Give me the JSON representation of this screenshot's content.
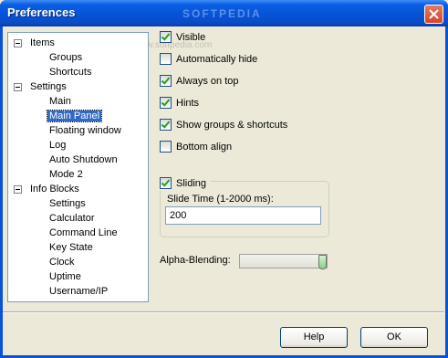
{
  "window": {
    "title": "Preferences",
    "watermark": "SOFTPEDIA",
    "watermark_url": "www.softpedia.com"
  },
  "tree": {
    "items": [
      {
        "label": "Items",
        "toggle": true
      },
      {
        "label": "Groups"
      },
      {
        "label": "Shortcuts"
      },
      {
        "label": "Settings",
        "toggle": true
      },
      {
        "label": "Main"
      },
      {
        "label": "Main Panel",
        "selected": true
      },
      {
        "label": "Floating window"
      },
      {
        "label": "Log"
      },
      {
        "label": "Auto Shutdown"
      },
      {
        "label": "Mode 2"
      },
      {
        "label": "Info Blocks",
        "toggle": true
      },
      {
        "label": "Settings"
      },
      {
        "label": "Calculator"
      },
      {
        "label": "Command Line"
      },
      {
        "label": "Key State"
      },
      {
        "label": "Clock"
      },
      {
        "label": "Uptime"
      },
      {
        "label": "Username/IP"
      }
    ]
  },
  "options": [
    {
      "label": "Visible",
      "checked": true
    },
    {
      "label": "Automatically hide",
      "checked": false
    },
    {
      "label": "Always on top",
      "checked": true
    },
    {
      "label": "Hints",
      "checked": true
    },
    {
      "label": "Show groups & shortcuts",
      "checked": true
    },
    {
      "label": "Bottom align",
      "checked": false
    }
  ],
  "sliding": {
    "label": "Sliding",
    "checked": true,
    "time_label": "Slide Time (1-2000 ms):",
    "time_value": "200"
  },
  "alpha": {
    "label": "Alpha-Blending:",
    "level": 1.0
  },
  "buttons": {
    "help": "Help",
    "ok": "OK"
  },
  "colors": {
    "title_bar": "#0653d6",
    "selection": "#316ac5",
    "check": "#21a121"
  }
}
